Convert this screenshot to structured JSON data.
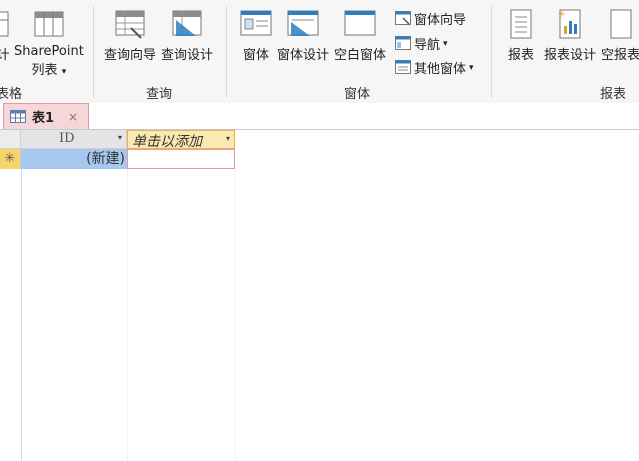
{
  "ribbon": {
    "groups": [
      {
        "label": "表格"
      },
      {
        "label": "查询"
      },
      {
        "label": "窗体"
      },
      {
        "label": "报表"
      }
    ],
    "buttons": {
      "design_partial": "计",
      "sharepoint_line1": "SharePoint",
      "sharepoint_line2": "列表",
      "query_wizard": "查询向导",
      "query_design": "查询设计",
      "form": "窗体",
      "form_design": "窗体设计",
      "blank_form": "空白窗体",
      "form_wizard": "窗体向导",
      "navigation": "导航",
      "more_forms": "其他窗体",
      "report": "报表",
      "report_design": "报表设计",
      "blank_report": "空报表"
    },
    "dropdown_arrow": "▾"
  },
  "document": {
    "tab_title": "表1",
    "tab_close": "×"
  },
  "datasheet": {
    "columns": [
      {
        "header": "ID"
      },
      {
        "header": "单击以添加"
      }
    ],
    "new_row_marker": "✳",
    "new_row_id": "(新建)"
  },
  "colors": {
    "tab_bg": "#f6d7d9",
    "add_header_bg": "#fce8b2",
    "selected_cell": "#a7c8ee",
    "new_row_selector": "#f7d36b"
  }
}
